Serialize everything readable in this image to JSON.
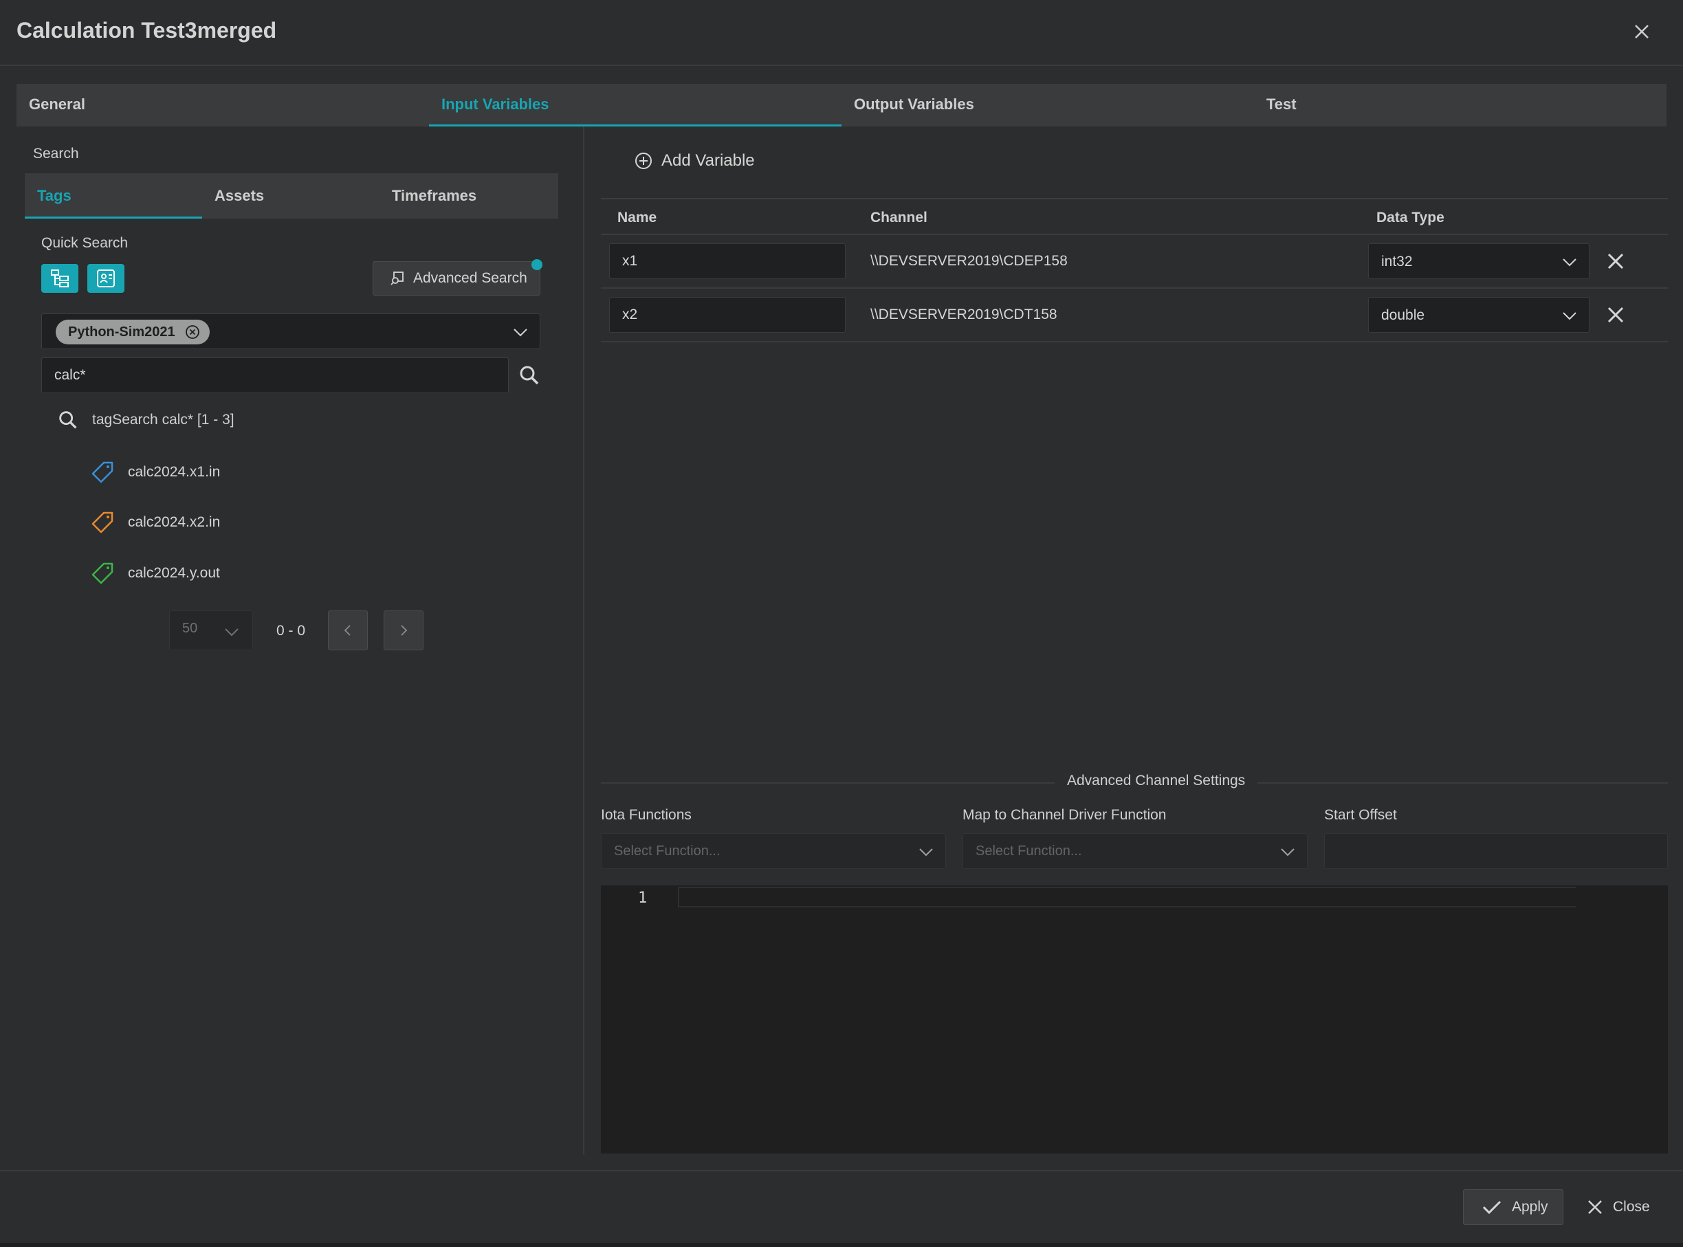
{
  "window": {
    "title": "Calculation Test3merged"
  },
  "main_tabs": [
    {
      "label": "General",
      "active": false
    },
    {
      "label": "Input Variables",
      "active": true
    },
    {
      "label": "Output Variables",
      "active": false
    },
    {
      "label": "Test",
      "active": false
    }
  ],
  "left": {
    "search_label": "Search",
    "sub_tabs": [
      {
        "label": "Tags",
        "active": true
      },
      {
        "label": "Assets",
        "active": false
      },
      {
        "label": "Timeframes",
        "active": false
      }
    ],
    "quick_search_label": "Quick Search",
    "quick_search_icons": [
      "hierarchy-icon",
      "asset-card-icon"
    ],
    "advanced_search_label": "Advanced Search",
    "source_chip": "Python-Sim2021",
    "search_value": "calc*",
    "result_header": "tagSearch calc* [1 - 3]",
    "tags": [
      {
        "name": "calc2024.x1.in",
        "color": "#3b8fd9"
      },
      {
        "name": "calc2024.x2.in",
        "color": "#e88a2e"
      },
      {
        "name": "calc2024.y.out",
        "color": "#3bb54a"
      }
    ],
    "pagination": {
      "page_size": "50",
      "range": "0 - 0"
    }
  },
  "right": {
    "add_variable_label": "Add Variable",
    "columns": [
      "Name",
      "Channel",
      "Data Type"
    ],
    "rows": [
      {
        "name": "x1",
        "channel": "\\\\DEVSERVER2019\\CDEP158",
        "type": "int32"
      },
      {
        "name": "x2",
        "channel": "\\\\DEVSERVER2019\\CDT158",
        "type": "double"
      }
    ],
    "advanced": {
      "title": "Advanced Channel Settings",
      "iota_label": "Iota Functions",
      "iota_placeholder": "Select Function...",
      "map_label": "Map to Channel Driver Function",
      "map_placeholder": "Select Function...",
      "offset_label": "Start Offset",
      "offset_value": ""
    },
    "editor": {
      "line_number": "1"
    }
  },
  "footer": {
    "apply_label": "Apply",
    "close_label": "Close"
  },
  "colors": {
    "accent": "#17a5b3",
    "background": "#2c2d2e"
  }
}
